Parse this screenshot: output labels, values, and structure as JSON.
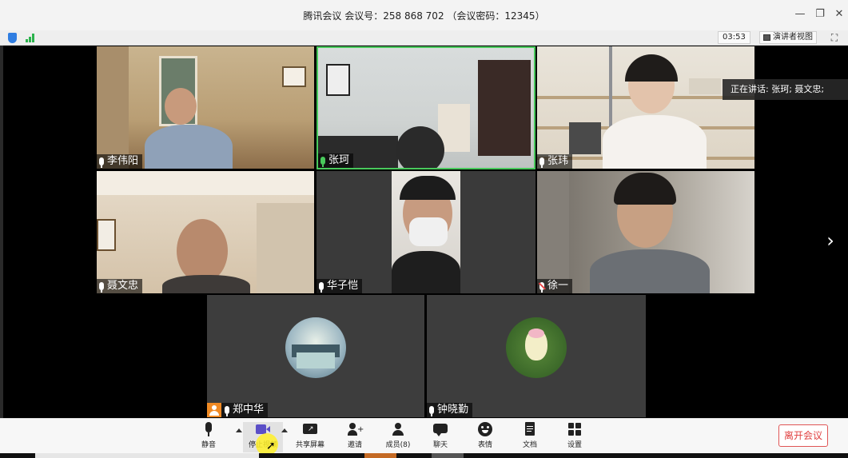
{
  "window": {
    "title": "腾讯会议 会议号：258 868 702 （会议密码：12345）",
    "minimize_icon": "minimize-icon",
    "maximize_icon": "restore-icon",
    "close_icon": "close-icon"
  },
  "infobar": {
    "timer": "03:53",
    "speaker_view_label": "演讲者视图"
  },
  "speaking_label": "正在讲话: 张珂; 聂文忠;",
  "participants": [
    {
      "name": "李伟阳",
      "mic": "on"
    },
    {
      "name": "张珂",
      "mic": "active"
    },
    {
      "name": "张玮",
      "mic": "on"
    },
    {
      "name": "聂文忠",
      "mic": "on"
    },
    {
      "name": "华子恺",
      "mic": "on"
    },
    {
      "name": "徐一",
      "mic": "muted"
    },
    {
      "name": "郑中华",
      "mic": "on",
      "host": true
    },
    {
      "name": "钟晓勤",
      "mic": "on"
    }
  ],
  "toolbar": {
    "mute_label": "静音",
    "stop_video_label": "停止视频",
    "share_label": "共享屏幕",
    "invite_label": "邀请",
    "members_label": "成员(8)",
    "chat_label": "聊天",
    "emoji_label": "表情",
    "docs_label": "文档",
    "settings_label": "设置",
    "leave_label": "离开会议"
  },
  "colors": {
    "accent": "#2f7de1",
    "active_speaker": "#49c95b",
    "leave": "#e04040",
    "host_badge": "#f08a24"
  }
}
